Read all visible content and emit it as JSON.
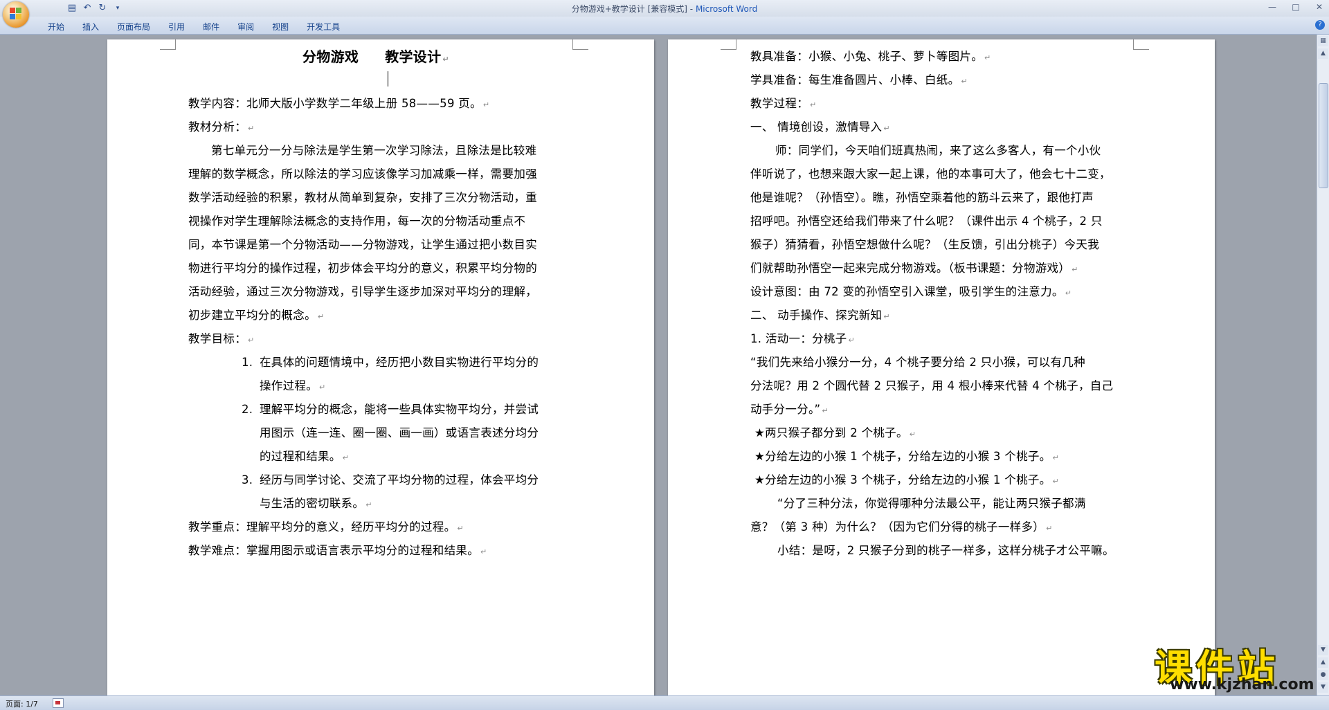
{
  "window": {
    "title": "分物游戏+教学设计 [兼容模式] - ",
    "app_name": "Microsoft Word"
  },
  "quick_access": {
    "save_icon": "save-icon",
    "undo_icon": "undo-icon",
    "redo_icon": "redo-icon",
    "customize_icon": "dropdown-icon"
  },
  "ribbon": {
    "tabs": [
      "开始",
      "插入",
      "页面布局",
      "引用",
      "邮件",
      "审阅",
      "视图",
      "开发工具"
    ]
  },
  "status": {
    "page_indicator": "页面: 1/7"
  },
  "watermark": {
    "text": "课件站",
    "url": "www.kjzhan.com"
  },
  "doc_left": {
    "title_part1": "分物游戏",
    "title_part2": "教学设计",
    "lines": [
      "教学内容：北师大版小学数学二年级上册 58——59 页。",
      "教材分析：",
      "第七单元分一分与除法是学生第一次学习除法，且除法是比较难",
      "理解的数学概念，所以除法的学习应该像学习加减乘一样，需要加强",
      "数学活动经验的积累，教材从简单到复杂，安排了三次分物活动，重",
      "视操作对学生理解除法概念的支持作用，每一次的分物活动重点不",
      "同，本节课是第一个分物活动——分物游戏，让学生通过把小数目实",
      "物进行平均分的操作过程，初步体会平均分的意义，积累平均分物的",
      "活动经验，通过三次分物游戏，引导学生逐步加深对平均分的理解，",
      "初步建立平均分的概念。",
      "教学目标：",
      "在具体的问题情境中，经历把小数目实物进行平均分的",
      "操作过程。",
      "理解平均分的概念，能将一些具体实物平均分，并尝试",
      "用图示（连一连、圈一圈、画一画）或语言表述分均分",
      "的过程和结果。",
      "经历与同学讨论、交流了平均分物的过程，体会平均分",
      "与生活的密切联系。",
      "教学重点：理解平均分的意义，经历平均分的过程。",
      "教学难点：掌握用图示或语言表示平均分的过程和结果。"
    ],
    "list_numbers": [
      "1.",
      "2.",
      "3."
    ]
  },
  "doc_right": {
    "lines": [
      "教具准备：小猴、小兔、桃子、萝卜等图片。",
      "学具准备：每生准备圆片、小棒、白纸。",
      "教学过程：",
      "一、  情境创设，激情导入",
      "师：同学们，今天咱们班真热闹，来了这么多客人，有一个小伙",
      "伴听说了，也想来跟大家一起上课，他的本事可大了，他会七十二变，",
      "他是谁呢？（孙悟空）。瞧，孙悟空乘着他的筋斗云来了，跟他打声",
      "招呼吧。孙悟空还给我们带来了什么呢？（课件出示 4 个桃子，2 只",
      "猴子）猜猜看，孙悟空想做什么呢？（生反馈，引出分桃子）今天我",
      "们就帮助孙悟空一起来完成分物游戏。（板书课题：分物游戏）",
      "设计意图：由 72 变的孙悟空引入课堂，吸引学生的注意力。",
      "二、  动手操作、探究新知",
      "1. 活动一：分桃子",
      "“我们先来给小猴分一分，4 个桃子要分给 2 只小猴，可以有几种",
      "分法呢？用 2 个圆代替 2 只猴子，用 4 根小棒来代替 4 个桃子，自己",
      "动手分一分。”",
      "★两只猴子都分到 2 个桃子。",
      "★分给左边的小猴 1 个桃子，分给左边的小猴 3 个桃子。",
      "★分给左边的小猴 3 个桃子，分给左边的小猴 1 个桃子。",
      "“分了三种分法，你觉得哪种分法最公平，能让两只猴子都满",
      "意？（第 3 种）为什么？（因为它们分得的桃子一样多）",
      "小结：是呀，2 只猴子分到的桃子一样多，这样分桃子才公平嘛。"
    ]
  },
  "colors": {
    "app_blue": "#1e57b8",
    "tab_text": "#15428b",
    "watermark_yellow": "#ffde00"
  }
}
